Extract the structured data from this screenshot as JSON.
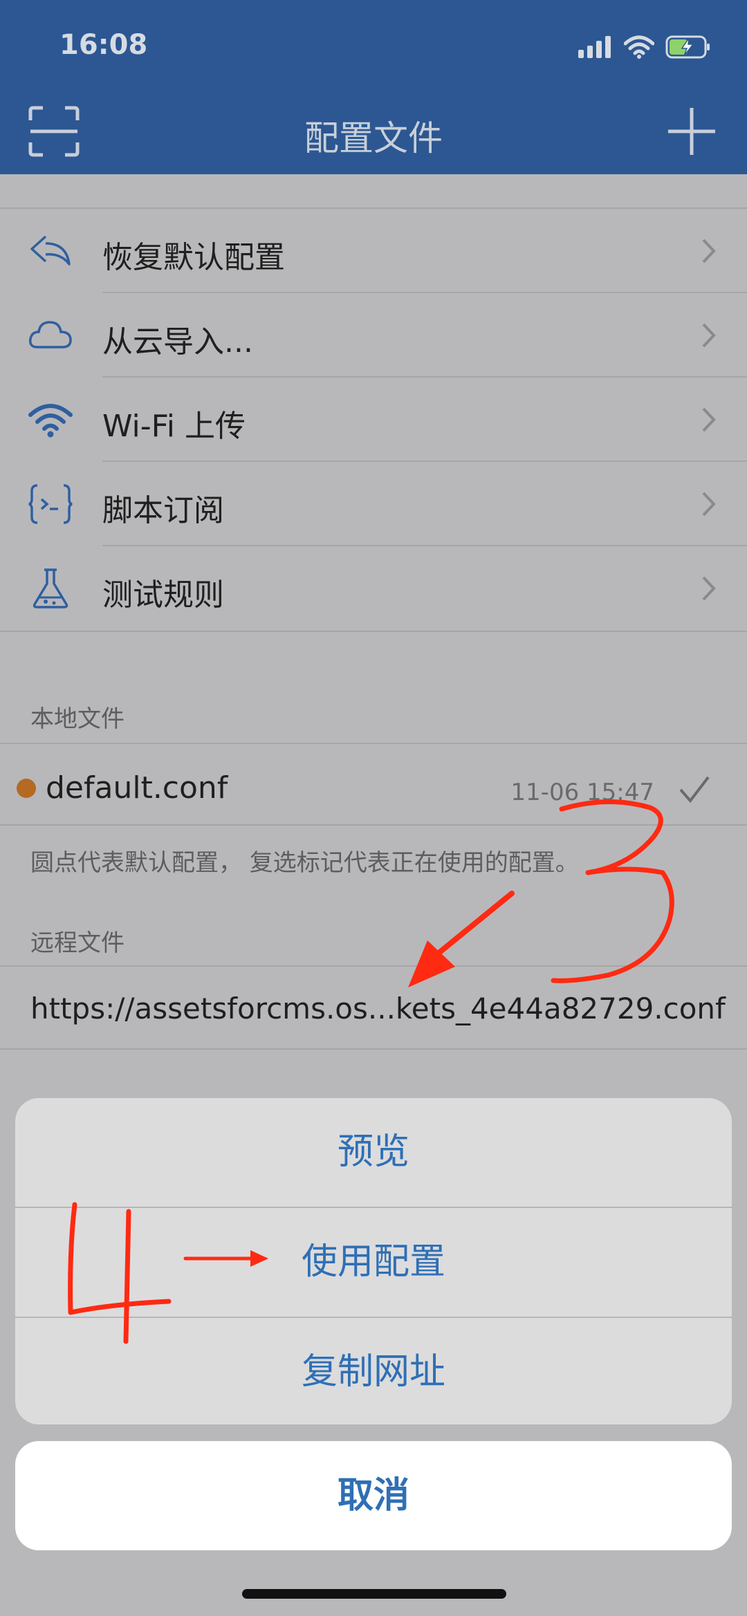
{
  "status_bar": {
    "time": "16:08"
  },
  "nav": {
    "title": "配置文件"
  },
  "menu": {
    "items": [
      {
        "label": "恢复默认配置",
        "icon": "undo-arrow-icon"
      },
      {
        "label": "从云导入...",
        "icon": "cloud-icon"
      },
      {
        "label": "Wi-Fi 上传",
        "icon": "wifi-icon"
      },
      {
        "label": "脚本订阅",
        "icon": "script-braces-icon"
      },
      {
        "label": "测试规则",
        "icon": "flask-icon"
      }
    ]
  },
  "local": {
    "section_title": "本地文件",
    "file_name": "default.conf",
    "timestamp": "11-06 15:47",
    "hint": "圆点代表默认配置， 复选标记代表正在使用的配置。"
  },
  "remote": {
    "section_title": "远程文件",
    "url": "https://assetsforcms.os...kets_4e44a82729.conf"
  },
  "action_sheet": {
    "options": [
      "预览",
      "使用配置",
      "复制网址"
    ],
    "cancel": "取消"
  },
  "colors": {
    "header_bg": "#2c5792",
    "accent": "#2f6fb5",
    "annotation": "#ff2a12",
    "default_dot": "#b46a22"
  }
}
